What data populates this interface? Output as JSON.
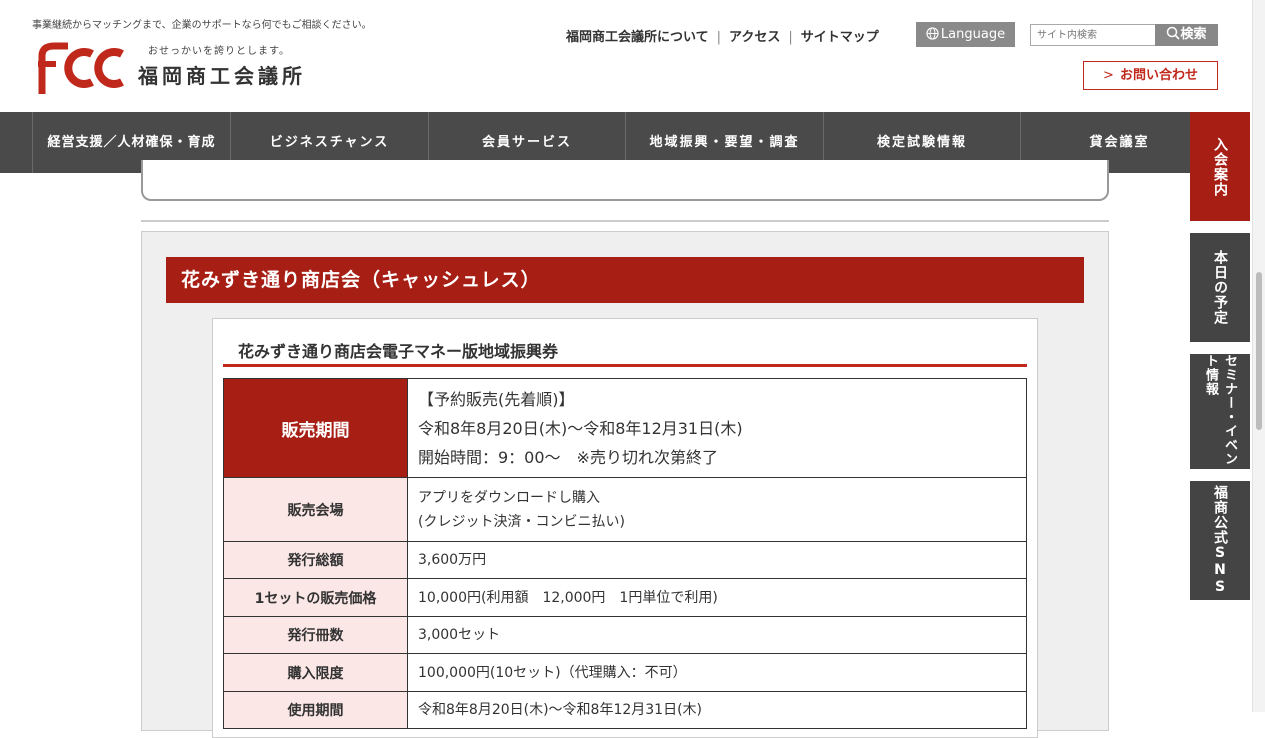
{
  "header": {
    "tagline": "事業継続からマッチングまで、企業のサポートなら何でもご相談ください。",
    "logo_mark": "fcci",
    "logo_sub": "おせっかいを誇りとします。",
    "logo_name": "福岡商工会議所",
    "links": [
      "福岡商工会議所について",
      "アクセス",
      "サイトマップ"
    ],
    "language_label": "Language",
    "search_placeholder": "サイト内検索",
    "search_button": "検索",
    "contact_label": "お問い合わせ"
  },
  "nav": [
    "経営支援／人材確保・育成",
    "ビジネスチャンス",
    "会員サービス",
    "地域振興・要望・調査",
    "検定試験情報",
    "貸会議室"
  ],
  "side_tabs": [
    "入会案内",
    "本日の予定",
    "セミナー・イベント情報",
    "福商公式SNS"
  ],
  "colors": {
    "accent": "#a61e14",
    "nav_bg": "#4a4a4a",
    "side_dark": "#444444"
  },
  "section": {
    "title": "花みずき通り商店会（キャッシュレス）",
    "card_title": "花みずき通り商店会電子マネー版地域振興券",
    "rows": [
      {
        "label": "販売期間",
        "lines": [
          "【予約販売(先着順)】",
          "令和8年8月20日(木)〜令和8年12月31日(木)",
          "開始時間：9：00〜　※売り切れ次第終了"
        ]
      },
      {
        "label": "販売会場",
        "lines": [
          "アプリをダウンロードし購入",
          "(クレジット決済・コンビニ払い)"
        ]
      },
      {
        "label": "発行総額",
        "lines": [
          "3,600万円"
        ]
      },
      {
        "label": "1セットの販売価格",
        "lines": [
          "10,000円(利用額　12,000円　1円単位で利用)"
        ]
      },
      {
        "label": "発行冊数",
        "lines": [
          "3,000セット"
        ]
      },
      {
        "label": "購入限度",
        "lines": [
          "100,000円(10セット)（代理購入：不可）"
        ]
      },
      {
        "label": "使用期間",
        "lines": [
          "令和8年8月20日(木)〜令和8年12月31日(木)"
        ]
      }
    ]
  }
}
